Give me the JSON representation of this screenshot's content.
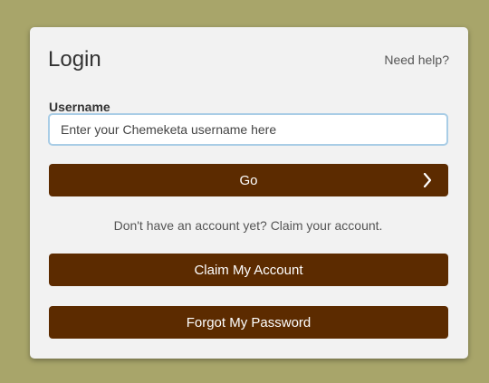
{
  "login_card": {
    "title": "Login",
    "help_link": "Need help?",
    "username_label": "Username",
    "username_placeholder": "Enter your Chemeketa username here",
    "username_value": "",
    "go_button": "Go",
    "claim_prompt": "Don't have an account yet? Claim your account.",
    "claim_button": "Claim My Account",
    "forgot_button": "Forgot My Password"
  },
  "icons": {
    "go_arrow": "chevron-right-icon"
  },
  "colors": {
    "background": "#a8a56a",
    "card": "#f2f2f2",
    "button": "#5c2b00",
    "input_border": "#a9cde6"
  }
}
